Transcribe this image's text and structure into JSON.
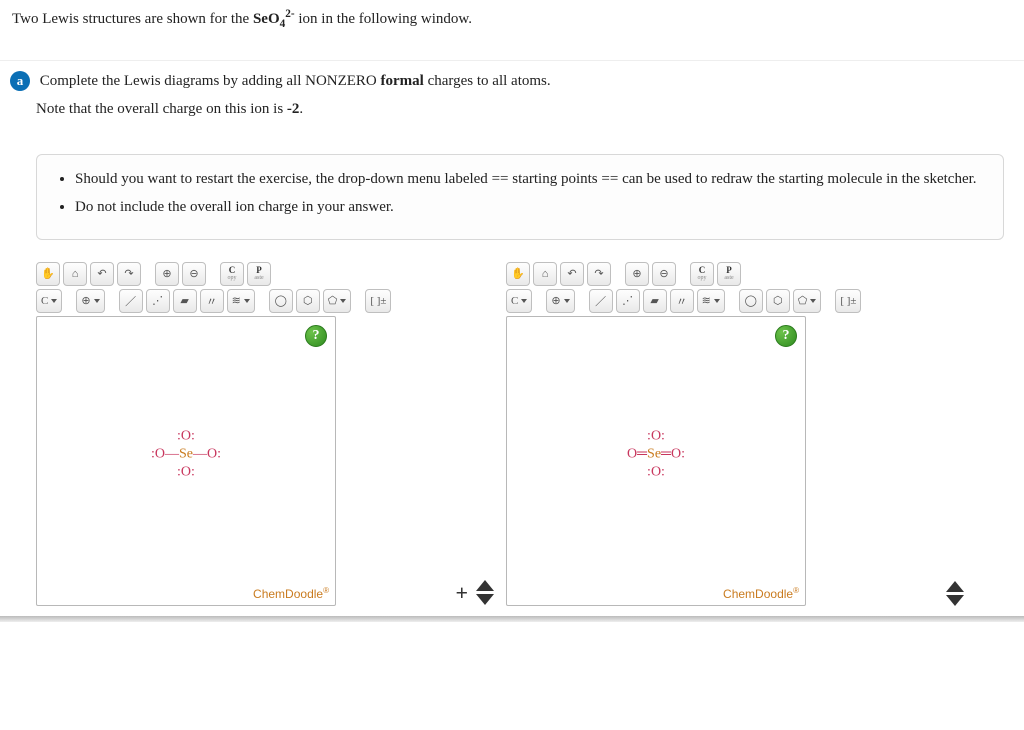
{
  "intro": {
    "prefix": "Two Lewis structures are shown for the ",
    "formula_base": "SeO",
    "formula_sub": "4",
    "formula_sup": "2-",
    "suffix": " ion in the following window."
  },
  "part": {
    "badge": "a",
    "line1_pre": "Complete the Lewis diagrams by adding all NONZERO ",
    "line1_bold": "formal",
    "line1_post": " charges to all atoms.",
    "line2_pre": "Note that the overall charge on this ion is ",
    "line2_bold": "-2",
    "line2_post": "."
  },
  "hints": {
    "h1_a": "Should you want to restart the exercise, the drop-down menu labeled ",
    "h1_b": "== starting points ==",
    "h1_c": " can be used to redraw the starting molecule in the sketcher.",
    "h2": "Do not include the overall ion charge in your answer."
  },
  "toolbar": {
    "hand": "✋",
    "home": "⌂",
    "undo": "↶",
    "redo": "↷",
    "zoomin": "⊕",
    "zoomout": "⊖",
    "copy_c": "C",
    "copy_lbl": "opy",
    "paste_p": "P",
    "paste_lbl": "aste",
    "element_c": "C",
    "add": "⊕",
    "bond1": "／",
    "bond2": "⋰",
    "bond3": "▰",
    "bond4": "〃",
    "bond5": "≋",
    "ring1": "◯",
    "ring2": "⬡",
    "ring3": "⬠",
    "bracket": "[ ]±"
  },
  "help": "?",
  "brand": "ChemDoodle",
  "brand_r": "®",
  "plus": "+",
  "molecule_left": {
    "row1": "      :O:      ",
    "row2_a": ":O—",
    "row2_se": "Se",
    "row2_b": "—O:",
    "row3": "      :O:      "
  },
  "molecule_right": {
    "row1": "      :O:      ",
    "row2_a": "O═",
    "row2_se": "Se",
    "row2_b": "═O:",
    "row3": "      :O:      "
  }
}
